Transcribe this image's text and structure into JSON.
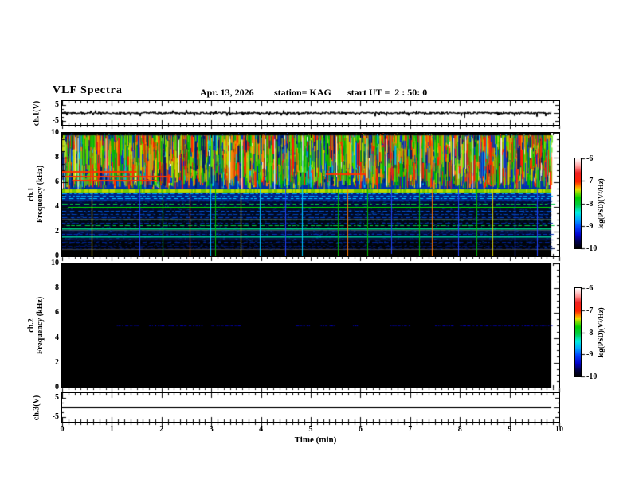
{
  "header": {
    "title": "VLF Spectra",
    "date": "Apr. 13, 2026",
    "station": "station= KAG",
    "start_ut": "start UT =  2 : 50: 0"
  },
  "left_axis_labels": {
    "ch1_wave": "ch.1(V)",
    "ch1_spec_line1": "ch.1",
    "ch1_spec_line2": "Frequency (kHz)",
    "ch2_spec_line1": "ch.2",
    "ch2_spec_line2": "Frequency (kHz)",
    "ch3_wave": "ch.3(V)"
  },
  "x_axis": {
    "label": "Time (min)",
    "tick_labels": [
      "0",
      "1",
      "2",
      "3",
      "4",
      "5",
      "6",
      "7",
      "8",
      "9",
      "10"
    ]
  },
  "y_axis": {
    "spec_tick_labels": [
      "10",
      "8",
      "6",
      "4",
      "2",
      "0"
    ],
    "wave_tick_labels": [
      "5",
      "-5"
    ]
  },
  "colorbar": {
    "label": "log(PSD)(V²/Hz)",
    "tick_labels": [
      "-6",
      "-7",
      "-8",
      "-9",
      "-10"
    ],
    "stops": [
      {
        "p": 0.0,
        "c": "#000000"
      },
      {
        "p": 0.07,
        "c": "#000044"
      },
      {
        "p": 0.15,
        "c": "#0000cc"
      },
      {
        "p": 0.24,
        "c": "#0044ff"
      },
      {
        "p": 0.32,
        "c": "#00aaff"
      },
      {
        "p": 0.4,
        "c": "#00eedd"
      },
      {
        "p": 0.48,
        "c": "#00cc44"
      },
      {
        "p": 0.56,
        "c": "#00cc00"
      },
      {
        "p": 0.62,
        "c": "#88dd00"
      },
      {
        "p": 0.655,
        "c": "#eedd00"
      },
      {
        "p": 0.69,
        "c": "#ff8800"
      },
      {
        "p": 0.74,
        "c": "#ff2200"
      },
      {
        "p": 0.84,
        "c": "#ee2222"
      },
      {
        "p": 0.91,
        "c": "#ff9999"
      },
      {
        "p": 0.97,
        "c": "#ffe2e2"
      },
      {
        "p": 1.0,
        "c": "#ffffff"
      }
    ]
  },
  "chart_data": {
    "type": "heatmap",
    "title": "VLF Spectra",
    "xlabel": "Time (min)",
    "xlim_min": [
      0,
      10
    ],
    "data_end_min": 9.84,
    "colorbar_range_log_psd": [
      -10,
      -6
    ],
    "panels": [
      {
        "panel": "ch1-waveform",
        "type": "line",
        "ylabel": "ch.1(V)",
        "ylim": [
          -5,
          5
        ],
        "baseline_v": 0,
        "noise_v": 0.5,
        "spikes": [
          {
            "t": 0.45,
            "v": -1.2
          },
          {
            "t": 1.3,
            "v": -1.0
          },
          {
            "t": 2.35,
            "v": -1.1
          },
          {
            "t": 3.36,
            "v": 3.8
          },
          {
            "t": 3.5,
            "v": 1.4
          },
          {
            "t": 5.2,
            "v": -1.0
          },
          {
            "t": 6.87,
            "v": 1.6
          },
          {
            "t": 8.1,
            "v": -3.0
          },
          {
            "t": 9.2,
            "v": -1.1
          }
        ]
      },
      {
        "panel": "ch1-spectrogram",
        "type": "heatmap",
        "ylabel": "Frequency (kHz)",
        "ylim_khz": [
          0,
          10
        ],
        "active_band_khz": [
          5.45,
          9.78
        ],
        "bright_band_khz": [
          5.25,
          5.45
        ],
        "red_cluster_centers_min": [
          0.7,
          1.6,
          2.1,
          3.7,
          4.1,
          5.9,
          6.9,
          7.3,
          8.3,
          8.9,
          9.4
        ],
        "horizontal_red_lines": [
          {
            "t0": 0.0,
            "t1": 1.5,
            "f": 6.9
          },
          {
            "t0": 0.0,
            "t1": 2.2,
            "f": 6.5
          },
          {
            "t0": 0.2,
            "t1": 1.9,
            "f": 6.2
          },
          {
            "t0": 5.3,
            "t1": 6.1,
            "f": 6.7
          }
        ],
        "low_bands": [
          {
            "f0": 4.5,
            "f1": 5.25,
            "color": "#002288"
          },
          {
            "f0": 4.0,
            "f1": 4.5,
            "color": "#000a33"
          },
          {
            "f0": 3.0,
            "f1": 4.0,
            "color": "#000a22"
          },
          {
            "f0": 2.1,
            "f1": 3.0,
            "color": "#000611"
          },
          {
            "f0": 1.3,
            "f1": 2.1,
            "color": "#000a33"
          },
          {
            "f0": 0.55,
            "f1": 1.3,
            "color": "#000408"
          },
          {
            "f0": 0.0,
            "f1": 0.55,
            "color": "#000000"
          }
        ],
        "rows": [
          {
            "f": 5.1,
            "color": "#00bbff",
            "style": "dash"
          },
          {
            "f": 4.9,
            "color": "#00aaff",
            "style": "dash"
          },
          {
            "f": 4.7,
            "color": "#00ccff",
            "style": "dash"
          },
          {
            "f": 4.5,
            "color": "#0088ff",
            "style": "dash"
          },
          {
            "f": 4.25,
            "color": "#00cc44",
            "style": "dash"
          },
          {
            "f": 4.0,
            "color": "#00dd00",
            "style": "solid"
          },
          {
            "f": 3.7,
            "color": "#0055dd",
            "style": "dash"
          },
          {
            "f": 3.45,
            "color": "#0044bb",
            "style": "dash"
          },
          {
            "f": 3.15,
            "color": "#0044cc",
            "style": "dash"
          },
          {
            "f": 2.95,
            "color": "#00bb66",
            "style": "dash"
          },
          {
            "f": 2.7,
            "color": "#0033aa",
            "style": "dash"
          },
          {
            "f": 2.5,
            "color": "#00cc44",
            "style": "dash"
          },
          {
            "f": 2.26,
            "color": "#00dd88",
            "style": "solid"
          },
          {
            "f": 2.0,
            "color": "#0044cc",
            "style": "dash"
          },
          {
            "f": 1.8,
            "color": "#0033bb",
            "style": "dash"
          },
          {
            "f": 1.6,
            "color": "#00cc99",
            "style": "solid"
          },
          {
            "f": 1.38,
            "color": "#0033aa",
            "style": "dash"
          },
          {
            "f": 1.15,
            "color": "#002299",
            "style": "dash"
          },
          {
            "f": 0.85,
            "color": "#001177",
            "style": "dash"
          },
          {
            "f": 0.62,
            "color": "#001155",
            "style": "dash"
          }
        ],
        "event_lines": [
          {
            "t": 0.6,
            "color": "#ddcc00"
          },
          {
            "t": 1.55,
            "color": "#2244ff"
          },
          {
            "t": 2.02,
            "color": "#00cc00"
          },
          {
            "t": 2.56,
            "color": "#ff5500"
          },
          {
            "t": 2.98,
            "color": "#00ccff"
          },
          {
            "t": 3.07,
            "color": "#00bb00"
          },
          {
            "t": 3.59,
            "color": "#ddcc00"
          },
          {
            "t": 3.98,
            "color": "#00ccff"
          },
          {
            "t": 4.49,
            "color": "#2244ff"
          },
          {
            "t": 4.83,
            "color": "#00ccff"
          },
          {
            "t": 5.55,
            "color": "#00bb00"
          },
          {
            "t": 5.74,
            "color": "#ff7700"
          },
          {
            "t": 6.14,
            "color": "#00bb00"
          },
          {
            "t": 6.62,
            "color": "#2244ff"
          },
          {
            "t": 7.18,
            "color": "#00bb00"
          },
          {
            "t": 7.43,
            "color": "#ff7700"
          },
          {
            "t": 7.96,
            "color": "#2244ff"
          },
          {
            "t": 8.33,
            "color": "#00bb00"
          },
          {
            "t": 8.65,
            "color": "#ddcc00"
          },
          {
            "t": 9.1,
            "color": "#2244ff"
          },
          {
            "t": 9.55,
            "color": "#2244ff"
          }
        ]
      },
      {
        "panel": "ch2-spectrogram",
        "type": "heatmap",
        "ylabel": "Frequency (kHz)",
        "ylim_khz": [
          0,
          10
        ],
        "background": "#000000",
        "line_khz": 5.0,
        "line_color": "#0000cc",
        "line_segments_min": [
          [
            1.1,
            1.55
          ],
          [
            1.75,
            2.8
          ],
          [
            3.0,
            3.6
          ],
          [
            4.7,
            5.0
          ],
          [
            5.2,
            5.5
          ],
          [
            5.85,
            5.95
          ],
          [
            6.6,
            7.0
          ],
          [
            7.5,
            7.85
          ],
          [
            8.0,
            9.84
          ]
        ]
      },
      {
        "panel": "ch3-waveform",
        "type": "line",
        "ylabel": "ch.3(V)",
        "ylim": [
          -5,
          5
        ],
        "flat_value_v": 0
      }
    ]
  }
}
